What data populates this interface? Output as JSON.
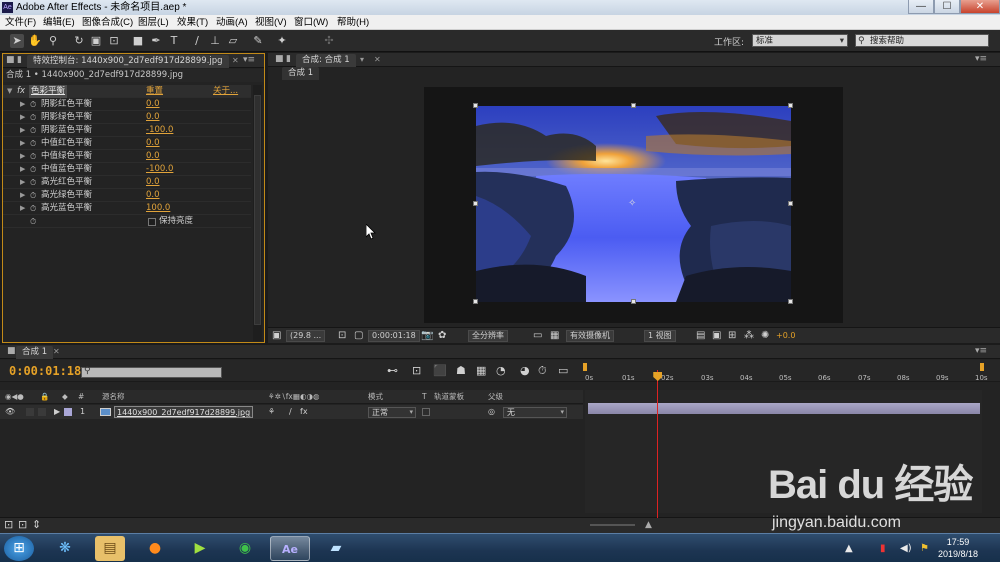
{
  "window": {
    "title": "Adobe After Effects - 未命名项目.aep *",
    "app_icon": "Ae",
    "minimize": "—",
    "maximize": "☐",
    "close": "✕"
  },
  "menu": [
    "文件(F)",
    "编辑(E)",
    "图像合成(C)",
    "图层(L)",
    "效果(T)",
    "动画(A)",
    "视图(V)",
    "窗口(W)",
    "帮助(H)"
  ],
  "toolbar": {
    "workspace_label": "工作区:",
    "workspace_value": "标准",
    "help_search_placeholder": "搜索帮助"
  },
  "effect_controls": {
    "tab_label": "特效控制台: 1440x900_2d7edf917d28899.jpg",
    "subtitle": "合成 1 • 1440x900_2d7edf917d28899.jpg",
    "fx_label": "fx",
    "effect_name": "色彩平衡",
    "reset_label": "重置",
    "about_label": "关于...",
    "params": [
      {
        "name": "阴影红色平衡",
        "value": "0.0"
      },
      {
        "name": "阴影绿色平衡",
        "value": "0.0"
      },
      {
        "name": "阴影蓝色平衡",
        "value": "-100.0"
      },
      {
        "name": "中值红色平衡",
        "value": "0.0"
      },
      {
        "name": "中值绿色平衡",
        "value": "0.0"
      },
      {
        "name": "中值蓝色平衡",
        "value": "-100.0"
      },
      {
        "name": "高光红色平衡",
        "value": "0.0"
      },
      {
        "name": "高光绿色平衡",
        "value": "0.0"
      },
      {
        "name": "高光蓝色平衡",
        "value": "100.0"
      }
    ],
    "preserve_luminosity": "保持亮度"
  },
  "composition": {
    "tab_label": "合成: 合成 1",
    "sub_tab": "合成 1",
    "bottom": {
      "zoom": "(29.8 ...",
      "timecode": "0:00:01:18",
      "resolution": "全分辨率",
      "camera": "有效摄像机",
      "views": "1 视图",
      "exposure": "+0.0"
    }
  },
  "timeline": {
    "tab_label": "合成 1",
    "timecode": "0:00:01:18",
    "ruler_ticks": [
      "0s",
      "01s",
      "02s",
      "03s",
      "04s",
      "05s",
      "06s",
      "07s",
      "08s",
      "09s",
      "10s"
    ],
    "playhead_seconds": 1.75,
    "columns": {
      "source_name": "源名称",
      "mode": "模式",
      "t": "T",
      "track_matte": "轨道蒙板",
      "parent": "父级"
    },
    "layer": {
      "index": "1",
      "name": "1440x900_2d7edf917d28899.jpg",
      "mode": "正常",
      "parent": "无"
    }
  },
  "taskbar": {
    "time": "17:59",
    "date": "2019/8/18"
  },
  "watermark": {
    "brand": "Bai du 经验",
    "url": "jingyan.baidu.com"
  }
}
